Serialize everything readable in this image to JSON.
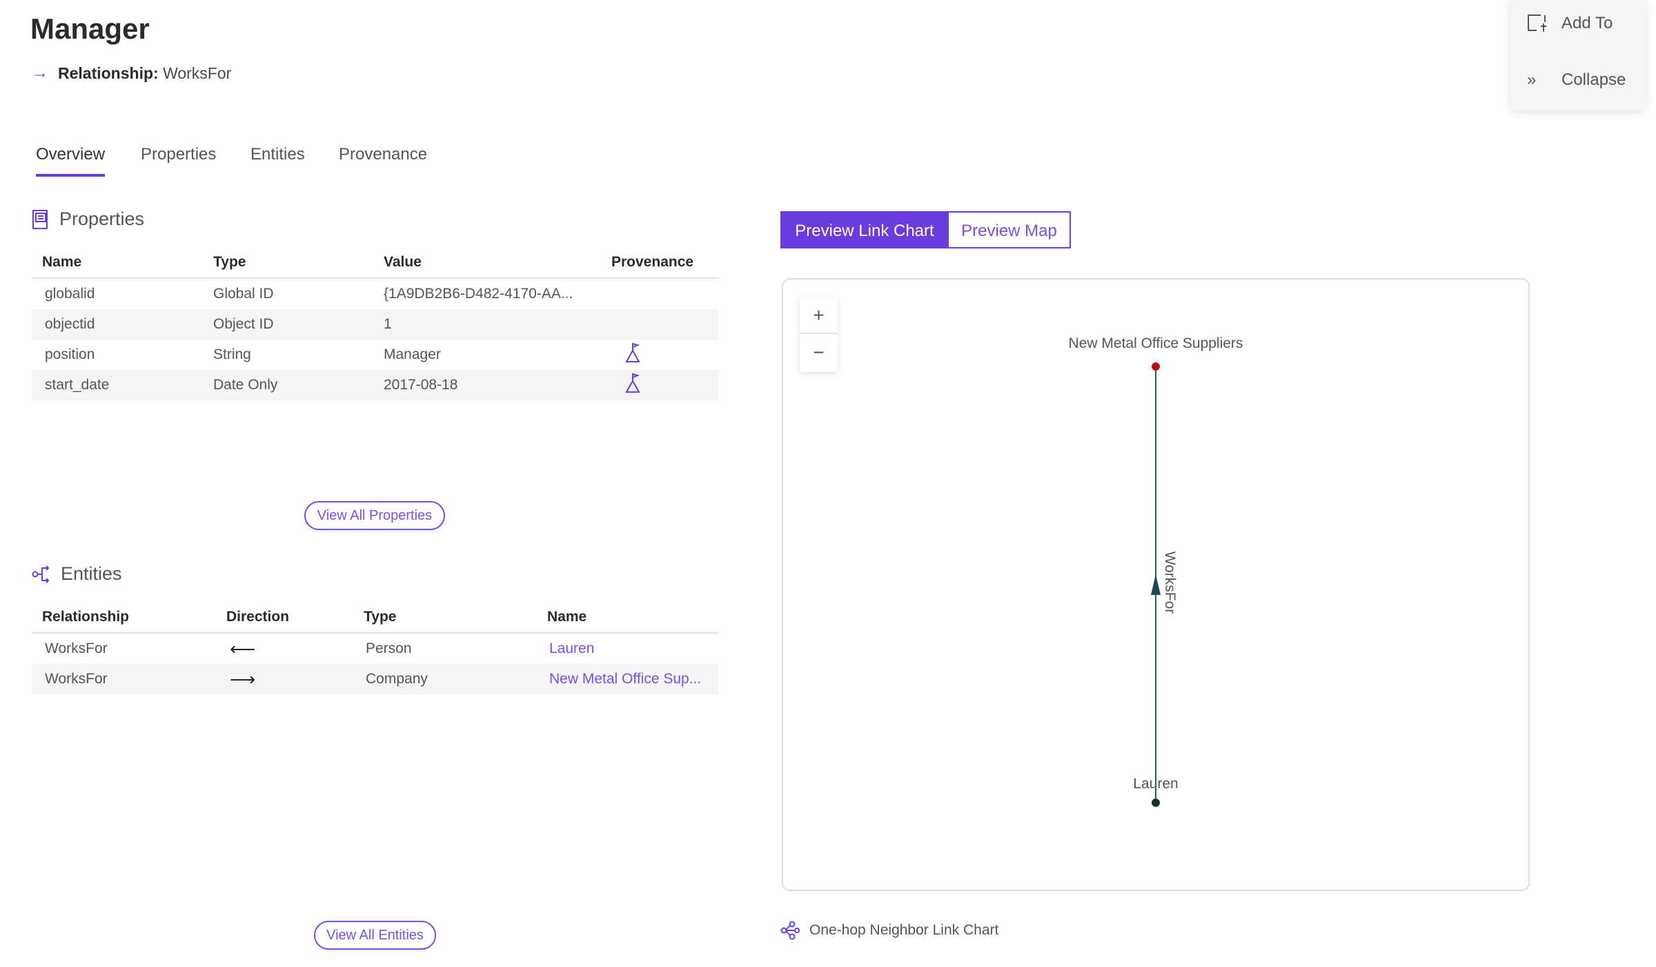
{
  "header": {
    "title": "Manager",
    "relationship_label": "Relationship:",
    "relationship_value": "WorksFor"
  },
  "tabs": [
    {
      "label": "Overview",
      "active": true
    },
    {
      "label": "Properties"
    },
    {
      "label": "Entities"
    },
    {
      "label": "Provenance"
    }
  ],
  "properties": {
    "heading": "Properties",
    "columns": [
      "Name",
      "Type",
      "Value",
      "Provenance"
    ],
    "rows": [
      {
        "name": "globalid",
        "type": "Global ID",
        "value": "{1A9DB2B6-D482-4170-AA...",
        "provenance": false
      },
      {
        "name": "objectid",
        "type": "Object ID",
        "value": "1",
        "provenance": false
      },
      {
        "name": "position",
        "type": "String",
        "value": "Manager",
        "provenance": true
      },
      {
        "name": "start_date",
        "type": "Date Only",
        "value": "2017-08-18",
        "provenance": true
      }
    ],
    "view_all": "View All Properties"
  },
  "entities": {
    "heading": "Entities",
    "columns": [
      "Relationship",
      "Direction",
      "Type",
      "Name"
    ],
    "rows": [
      {
        "relationship": "WorksFor",
        "direction": "⟵",
        "type": "Person",
        "name": "Lauren"
      },
      {
        "relationship": "WorksFor",
        "direction": "⟶",
        "type": "Company",
        "name": "New Metal Office Sup..."
      }
    ],
    "view_all": "View All Entities"
  },
  "preview": {
    "buttons": [
      {
        "label": "Preview Link Chart",
        "active": true
      },
      {
        "label": "Preview Map"
      }
    ],
    "zoom_in": "+",
    "zoom_out": "−",
    "nodes": [
      {
        "label": "New Metal Office Suppliers",
        "color": "#b5121b"
      },
      {
        "label": "Lauren",
        "color": "#1a2a33"
      }
    ],
    "edge": {
      "label": "WorksFor",
      "from": "Lauren",
      "to": "New Metal Office Suppliers",
      "color": "#1f5d66"
    },
    "footer": "One-hop Neighbor Link Chart"
  },
  "panel": {
    "add_to": "Add To",
    "collapse": "Collapse"
  },
  "colors": {
    "accent": "#6a3be0"
  }
}
